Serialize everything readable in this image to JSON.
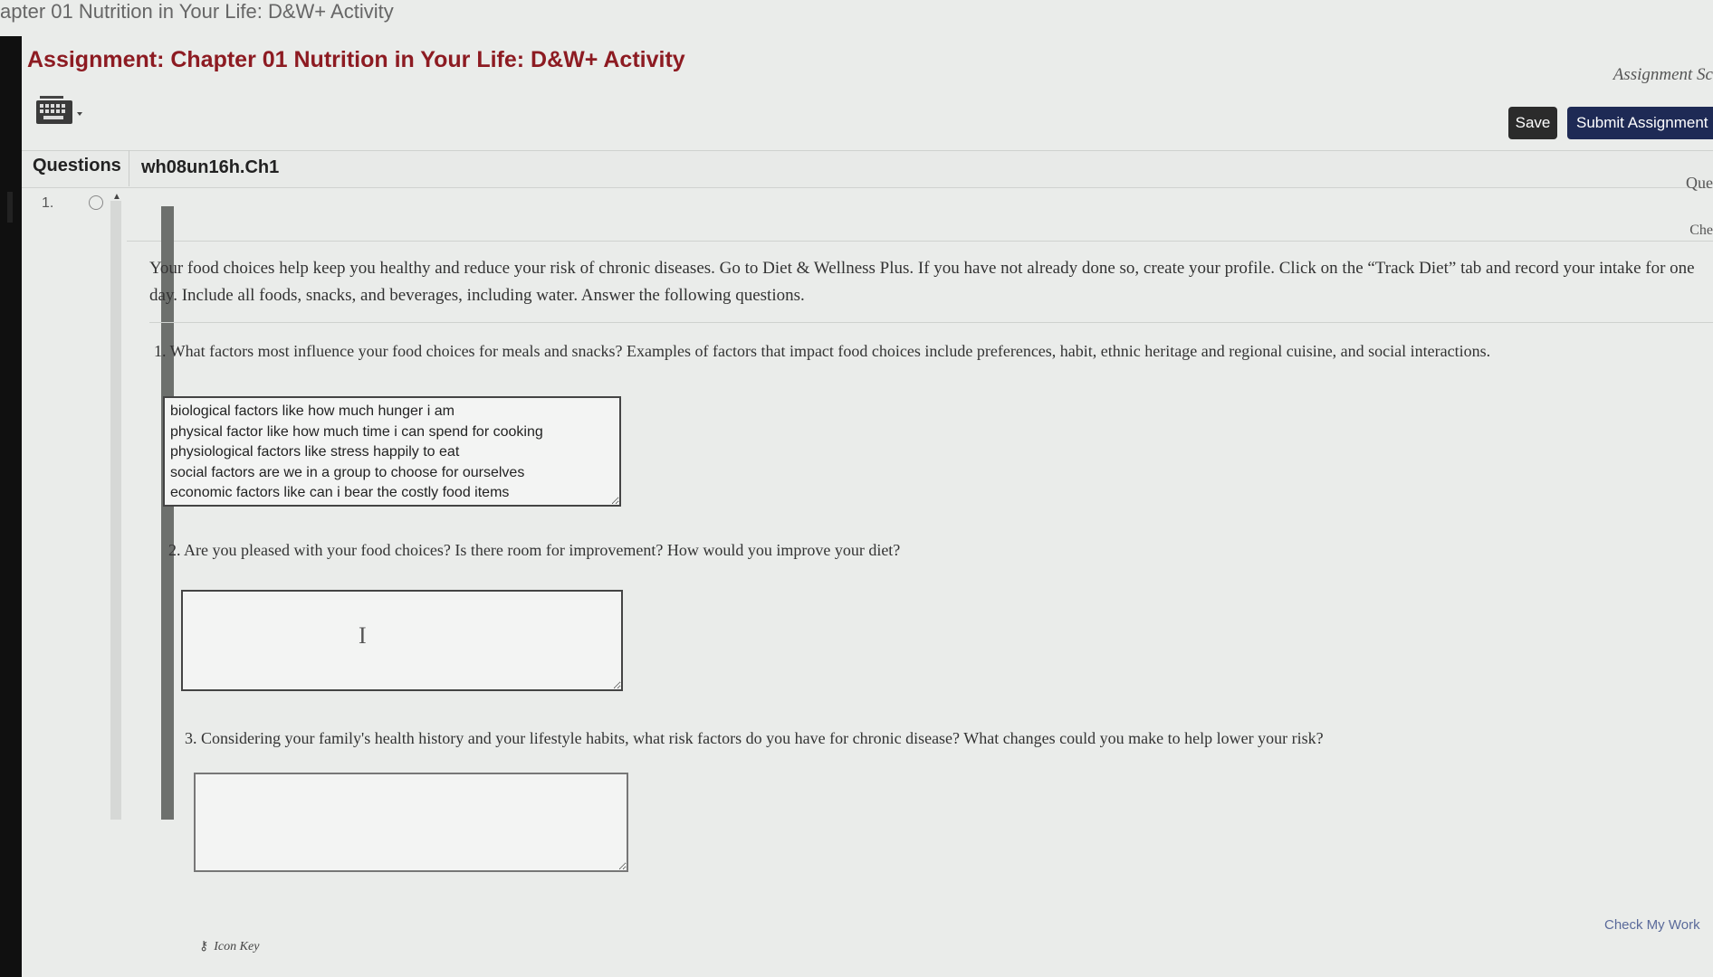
{
  "browser": {
    "title": "apter 01 Nutrition in Your Life: D&W+ Activity"
  },
  "header": {
    "assignment_title": "Assignment: Chapter 01 Nutrition in Your Life: D&W+ Activity",
    "score_label": "Assignment Sc",
    "keyboard_icon": "keyboard-icon"
  },
  "toolbar": {
    "save_label": "Save",
    "submit_label": "Submit Assignment"
  },
  "tabs": {
    "questions_label": "Questions",
    "question_id": "wh08un16h.Ch1",
    "right_question_label": "Que",
    "right_check_label": "Che"
  },
  "question_nav": {
    "items": [
      {
        "number": "1.",
        "status_icon": "circle-outline-icon"
      }
    ]
  },
  "question": {
    "intro": "Your food choices help keep you healthy and reduce your risk of chronic diseases. Go to Diet & Wellness Plus. If you have not already done so, create your profile. Click on the “Track Diet” tab and record your intake for one day. Include all foods, snacks, and beverages, including water. Answer the following questions.",
    "parts": [
      {
        "prompt": "1. What factors most influence your food choices for meals and snacks? Examples of factors that impact food choices include preferences, habit, ethnic heritage and regional cuisine, and social interactions.",
        "answer": "biological factors like how much hunger i am\nphysical factor like how much time i can spend for cooking\nphysiological factors like stress happily to eat\nsocial factors are we in a group to choose for ourselves\neconomic factors like can i bear the costly food items"
      },
      {
        "prompt": "2. Are you pleased with your food choices? Is there room for improvement? How would you improve your diet?",
        "answer": ""
      },
      {
        "prompt": "3. Considering your family's health history and your lifestyle habits, what risk factors do you have for chronic disease? What changes could you make to help lower your risk?",
        "answer": ""
      }
    ]
  },
  "footer": {
    "check_my_work_label": "Check My Work",
    "icon_key_label": "Icon Key",
    "icon_key_icon": "key-icon"
  }
}
